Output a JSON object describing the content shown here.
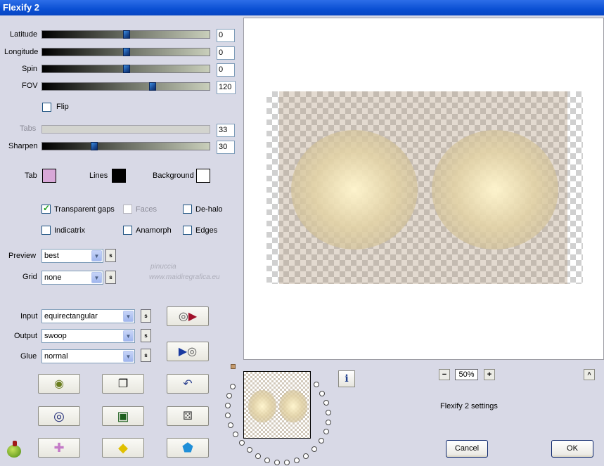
{
  "window": {
    "title": "Flexify 2"
  },
  "sliders": [
    {
      "label": "Latitude",
      "value": "0",
      "position": 0.5
    },
    {
      "label": "Longitude",
      "value": "0",
      "position": 0.5
    },
    {
      "label": "Spin",
      "value": "0",
      "position": 0.5
    },
    {
      "label": "FOV",
      "value": "120",
      "position": 0.66
    },
    {
      "label": "Tabs",
      "value": "33",
      "position": 0.33,
      "disabled": true
    },
    {
      "label": "Sharpen",
      "value": "30",
      "position": 0.3
    }
  ],
  "flip": {
    "label": "Flip",
    "checked": false
  },
  "colors": {
    "tab_label": "Tab",
    "tab_color": "#d8a8d8",
    "lines_label": "Lines",
    "lines_color": "#000000",
    "background_label": "Background",
    "background_color": "#ffffff"
  },
  "options": {
    "transparent_gaps": {
      "label": "Transparent gaps",
      "checked": true
    },
    "faces": {
      "label": "Faces",
      "checked": false,
      "disabled": true
    },
    "de_halo": {
      "label": "De-halo",
      "checked": false
    },
    "indicatrix": {
      "label": "Indicatrix",
      "checked": false
    },
    "anamorph": {
      "label": "Anamorph",
      "checked": false
    },
    "edges": {
      "label": "Edges",
      "checked": false
    }
  },
  "preview": {
    "label": "Preview",
    "value": "best"
  },
  "grid": {
    "label": "Grid",
    "value": "none"
  },
  "input": {
    "label": "Input",
    "value": "equirectangular"
  },
  "output": {
    "label": "Output",
    "value": "swoop"
  },
  "glue": {
    "label": "Glue",
    "value": "normal"
  },
  "s_label": "s",
  "watermark": {
    "line1": "pinuccia",
    "line2": "www.maidiregrafica.eu"
  },
  "zoom": {
    "value": "50%",
    "minus": "−",
    "plus": "+"
  },
  "settings_text": "Flexify 2 settings",
  "info_label": "i",
  "collapse_label": "^",
  "buttons": {
    "cancel": "Cancel",
    "ok": "OK"
  }
}
